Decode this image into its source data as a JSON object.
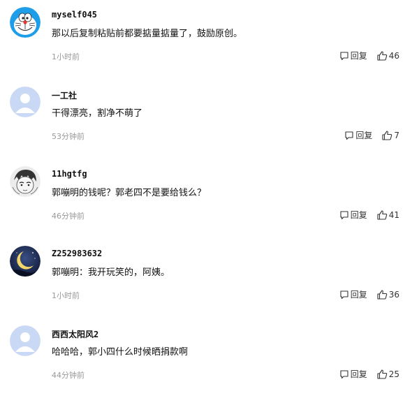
{
  "comments": [
    {
      "username": "myself045",
      "content": "那以后复制粘贴前都要掂量掂量了，鼓励原创。",
      "time": "1小时前",
      "reply_label": "回复",
      "likes": "46",
      "avatar": "doraemon-avatar"
    },
    {
      "username": "一工社",
      "content": "干得漂亮，割净不萌了",
      "time": "53分钟前",
      "reply_label": "回复",
      "likes": "7",
      "avatar": "default-avatar"
    },
    {
      "username": "11hgtfg",
      "content": "郭嘣明的钱呢？郭老四不是要给钱么？",
      "time": "46分钟前",
      "reply_label": "回复",
      "likes": "41",
      "avatar": "sketch-avatar"
    },
    {
      "username": "Z252983632",
      "content": "郭嘣明：我开玩笑的，阿姨。",
      "time": "1小时前",
      "reply_label": "回复",
      "likes": "36",
      "avatar": "moon-avatar"
    },
    {
      "username": "西西太阳风2",
      "content": "哈哈哈，郭小四什么时候晒捐款啊",
      "time": "44分钟前",
      "reply_label": "回复",
      "likes": "25",
      "avatar": "default-avatar"
    }
  ],
  "colors": {
    "icon_blue": "#2a9fe0",
    "default_avatar_bg": "#c9d8f4",
    "time_gray": "#999999"
  }
}
